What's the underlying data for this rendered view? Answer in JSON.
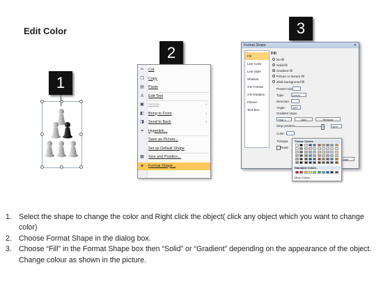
{
  "page": {
    "title": "Edit Color"
  },
  "steps": {
    "one": "1",
    "two": "2",
    "three": "3"
  },
  "context_menu": {
    "items": [
      {
        "label": "Cut",
        "icon": "scissors-icon",
        "glyph": "✂"
      },
      {
        "label": "Copy",
        "icon": "copy-icon",
        "glyph": "❐"
      },
      {
        "label": "Paste",
        "icon": "paste-icon",
        "glyph": "▤"
      },
      {
        "label": "Edit Text",
        "icon": "edit-text-icon",
        "glyph": "A"
      },
      {
        "label": "Group",
        "icon": "group-icon",
        "glyph": "▣"
      },
      {
        "label": "Bring to Front",
        "icon": "bring-front-icon",
        "glyph": "◧"
      },
      {
        "label": "Send to Back",
        "icon": "send-back-icon",
        "glyph": "◨"
      },
      {
        "label": "Hyperlink...",
        "icon": "hyperlink-icon",
        "glyph": "⚭"
      },
      {
        "label": "Save as Picture...",
        "icon": "",
        "glyph": ""
      },
      {
        "label": "Set as Default Shape",
        "icon": "",
        "glyph": ""
      },
      {
        "label": "Size and Position...",
        "icon": "size-position-icon",
        "glyph": "▦"
      },
      {
        "label": "Format Shape...",
        "icon": "format-shape-icon",
        "glyph": "◈"
      }
    ],
    "arrow": "›"
  },
  "dialog": {
    "title": "Format Shape",
    "close": "✕",
    "nav": [
      "Fill",
      "Line Color",
      "Line Style",
      "Shadow",
      "3-D Format",
      "3-D Rotation",
      "Picture",
      "Text Box"
    ],
    "fill_heading": "Fill",
    "fill_options": [
      "No fill",
      "Solid fill",
      "Gradient fill",
      "Picture or texture fill",
      "Slide background fill"
    ],
    "preset_colors": "Preset colors:",
    "type": "Type:",
    "type_value": "Linear",
    "direction": "Direction:",
    "angle": "Angle:",
    "angle_value": "300°",
    "gradient_stops": "Gradient stops",
    "stop_value": "Stop 1",
    "add": "Add",
    "remove": "Remove",
    "stop_position": "Stop position:",
    "stop_position_value": "96%",
    "color": "Color:",
    "transparency": "Transpa",
    "rotate": "Rotat",
    "close_button": "Close"
  },
  "palette": {
    "theme_colors": "Theme Colors",
    "standard_colors": "Standard Colors",
    "more_colors": "More Colors...",
    "theme_rows": [
      [
        "#ffffff",
        "#000000",
        "#eeece1",
        "#1f497d",
        "#4f81bd",
        "#c0504d",
        "#9bbb59",
        "#8064a2",
        "#4bacc6",
        "#f79646"
      ],
      [
        "#f2f2f2",
        "#7f7f7f",
        "#ddd9c3",
        "#c6d9f0",
        "#dbe5f1",
        "#f2dcdb",
        "#ebf1dd",
        "#e5e0ec",
        "#dbeef3",
        "#fdeada"
      ],
      [
        "#d8d8d8",
        "#595959",
        "#c4bd97",
        "#8db3e2",
        "#b8cce4",
        "#e5b9b7",
        "#d7e3bc",
        "#ccc1d9",
        "#b7dde8",
        "#fbd5b5"
      ],
      [
        "#bfbfbf",
        "#3f3f3f",
        "#938953",
        "#548dd4",
        "#95b3d7",
        "#d99694",
        "#c3d69b",
        "#b2a2c7",
        "#92cddc",
        "#fac08f"
      ],
      [
        "#a5a5a5",
        "#262626",
        "#494429",
        "#17365d",
        "#366092",
        "#953734",
        "#76923c",
        "#5f497a",
        "#31859b",
        "#e36c09"
      ],
      [
        "#7f7f7f",
        "#0c0c0c",
        "#1d1b10",
        "#0f243e",
        "#244061",
        "#632423",
        "#4f6128",
        "#3f3151",
        "#205867",
        "#974806"
      ]
    ],
    "standard": [
      "#c00000",
      "#ff0000",
      "#ffc000",
      "#ffff00",
      "#92d050",
      "#00b050",
      "#00b0f0",
      "#0070c0",
      "#002060",
      "#7030a0"
    ]
  },
  "instructions": [
    {
      "num": "1.",
      "text": "Select the shape to change the color and Right click the object( click any object which you want to change color)"
    },
    {
      "num": "2.",
      "text": "Choose Format Shape in the dialog box."
    },
    {
      "num": "3.",
      "text": "Choose “Fill” in the Format Shape box then “Solid” or “Gradient” depending on the appearance of the object. Change colour as shown in the picture."
    }
  ]
}
